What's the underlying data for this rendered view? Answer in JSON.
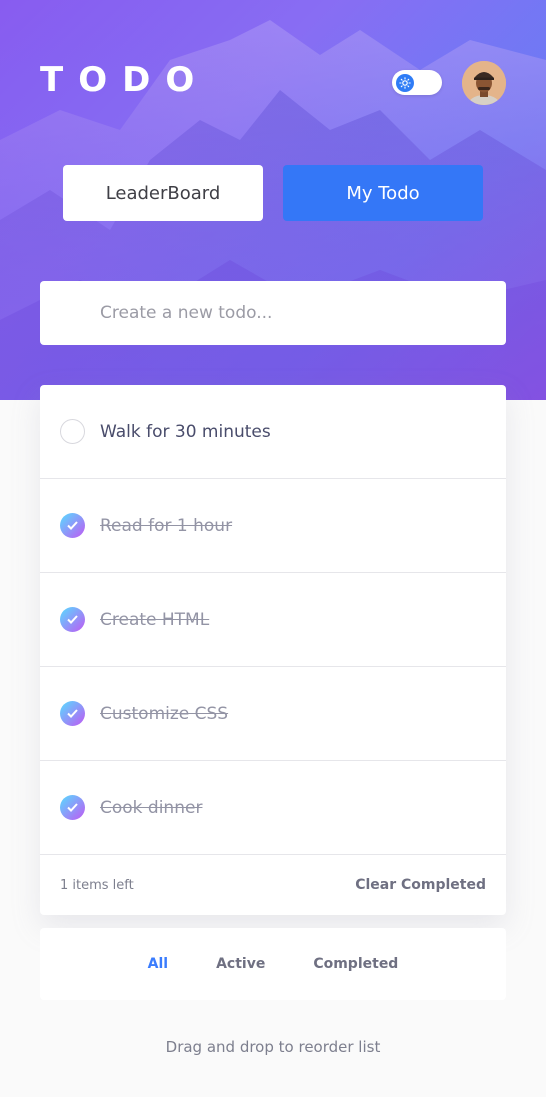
{
  "app": {
    "logo": "TODO",
    "theme_toggle_icon": "sun-icon",
    "avatar_icon": "user-avatar"
  },
  "nav": {
    "leaderboard_label": "LeaderBoard",
    "my_todo_label": "My Todo"
  },
  "new_todo": {
    "placeholder": "Create a new todo..."
  },
  "todos": [
    {
      "text": "Walk for 30 minutes",
      "completed": false
    },
    {
      "text": "Read for 1 hour",
      "completed": true
    },
    {
      "text": "Create HTML",
      "completed": true
    },
    {
      "text": "Customize CSS",
      "completed": true
    },
    {
      "text": "Cook dinner",
      "completed": true
    }
  ],
  "footer": {
    "items_left": "1 items left",
    "clear_completed": "Clear Completed"
  },
  "filters": {
    "all": "All",
    "active": "Active",
    "completed": "Completed",
    "selected": "All"
  },
  "hint": "Drag and drop to reorder list",
  "colors": {
    "accent": "#3477f7",
    "check_gradient_start": "#57ddff",
    "check_gradient_end": "#c058f3",
    "hero_purple": "#7b5cf0"
  }
}
